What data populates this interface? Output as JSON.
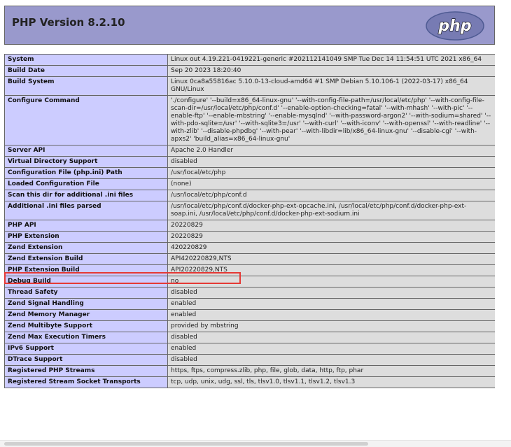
{
  "header": {
    "title": "PHP Version 8.2.10",
    "logo_text": "php",
    "logo_color": "#777bb3"
  },
  "table": [
    {
      "key": "System",
      "value": "Linux out 4.19.221-0419221-generic #202112141049 SMP Tue Dec 14 11:54:51 UTC 2021 x86_64"
    },
    {
      "key": "Build Date",
      "value": "Sep 20 2023 18:20:40"
    },
    {
      "key": "Build System",
      "value": "Linux 0ca8a55816ac 5.10.0-13-cloud-amd64 #1 SMP Debian 5.10.106-1 (2022-03-17) x86_64 GNU/Linux"
    },
    {
      "key": "Configure Command",
      "value": "'./configure' '--build=x86_64-linux-gnu' '--with-config-file-path=/usr/local/etc/php' '--with-config-file-scan-dir=/usr/local/etc/php/conf.d' '--enable-option-checking=fatal' '--with-mhash' '--with-pic' '--enable-ftp' '--enable-mbstring' '--enable-mysqlnd' '--with-password-argon2' '--with-sodium=shared' '--with-pdo-sqlite=/usr' '--with-sqlite3=/usr' '--with-curl' '--with-iconv' '--with-openssl' '--with-readline' '--with-zlib' '--disable-phpdbg' '--with-pear' '--with-libdir=lib/x86_64-linux-gnu' '--disable-cgi' '--with-apxs2' 'build_alias=x86_64-linux-gnu'"
    },
    {
      "key": "Server API",
      "value": "Apache 2.0 Handler"
    },
    {
      "key": "Virtual Directory Support",
      "value": "disabled"
    },
    {
      "key": "Configuration File (php.ini) Path",
      "value": "/usr/local/etc/php"
    },
    {
      "key": "Loaded Configuration File",
      "value": "(none)"
    },
    {
      "key": "Scan this dir for additional .ini files",
      "value": "/usr/local/etc/php/conf.d"
    },
    {
      "key": "Additional .ini files parsed",
      "value": "/usr/local/etc/php/conf.d/docker-php-ext-opcache.ini, /usr/local/etc/php/conf.d/docker-php-ext-soap.ini, /usr/local/etc/php/conf.d/docker-php-ext-sodium.ini"
    },
    {
      "key": "PHP API",
      "value": "20220829"
    },
    {
      "key": "PHP Extension",
      "value": "20220829"
    },
    {
      "key": "Zend Extension",
      "value": "420220829"
    },
    {
      "key": "Zend Extension Build",
      "value": "API420220829,NTS"
    },
    {
      "key": "PHP Extension Build",
      "value": "API20220829,NTS"
    },
    {
      "key": "Debug Build",
      "value": "no"
    },
    {
      "key": "Thread Safety",
      "value": "disabled"
    },
    {
      "key": "Zend Signal Handling",
      "value": "enabled"
    },
    {
      "key": "Zend Memory Manager",
      "value": "enabled"
    },
    {
      "key": "Zend Multibyte Support",
      "value": "provided by mbstring"
    },
    {
      "key": "Zend Max Execution Timers",
      "value": "disabled"
    },
    {
      "key": "IPv6 Support",
      "value": "enabled"
    },
    {
      "key": "DTrace Support",
      "value": "disabled"
    },
    {
      "key": "Registered PHP Streams",
      "value": "https, ftps, compress.zlib, php, file, glob, data, http, ftp, phar"
    },
    {
      "key": "Registered Stream Socket Transports",
      "value": "tcp, udp, unix, udg, ssl, tls, tlsv1.0, tlsv1.1, tlsv1.2, tlsv1.3"
    }
  ]
}
